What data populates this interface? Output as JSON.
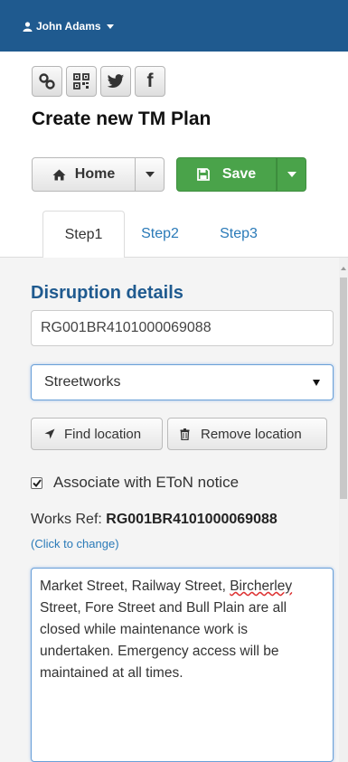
{
  "header": {
    "user_name": "John Adams",
    "background": "#1f5a8f"
  },
  "social_buttons": [
    {
      "icon": "link-icon"
    },
    {
      "icon": "qr-code-icon"
    },
    {
      "icon": "twitter-icon"
    },
    {
      "icon": "facebook-icon",
      "glyph": "f"
    }
  ],
  "page_title": "Create new TM Plan",
  "toolbar": {
    "home_label": "Home",
    "save_label": "Save",
    "save_color": "#4aa34a"
  },
  "tabs": [
    {
      "label": "Step1",
      "active": true
    },
    {
      "label": "Step2",
      "active": false
    },
    {
      "label": "Step3",
      "active": false
    }
  ],
  "form": {
    "section_title": "Disruption details",
    "reference_value": "RG001BR4101000069088",
    "type_selected": "Streetworks",
    "find_location_label": "Find location",
    "remove_location_label": "Remove location",
    "associate_checked": true,
    "associate_label": "Associate with EToN notice",
    "works_ref_label": "Works Ref:",
    "works_ref_value": "RG001BR4101000069088",
    "change_link": "(Click to change)",
    "description_parts": {
      "before": "Market Street, Railway Street, ",
      "misspelled": "Bircherley",
      "after": " Street, Fore Street and Bull Plain are all closed while maintenance work is undertaken. Emergency access will be maintained at all times."
    }
  }
}
